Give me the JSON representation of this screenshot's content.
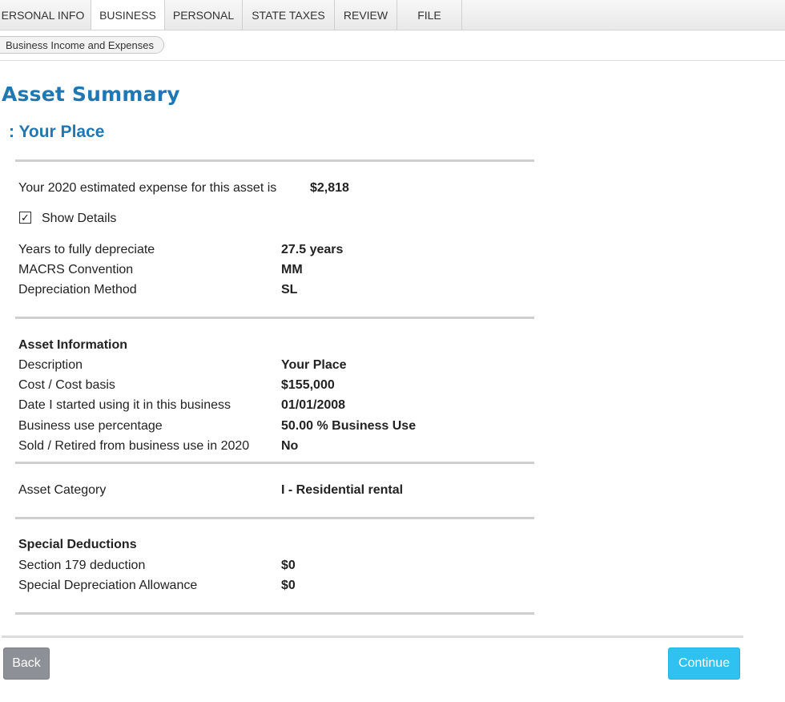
{
  "tabs": [
    {
      "label": "ERSONAL INFO",
      "active": false
    },
    {
      "label": "BUSINESS",
      "active": true
    },
    {
      "label": "PERSONAL",
      "active": false
    },
    {
      "label": "STATE TAXES",
      "active": false
    },
    {
      "label": "REVIEW",
      "active": false
    },
    {
      "label": "FILE",
      "active": false
    }
  ],
  "breadcrumb": "Business Income and Expenses",
  "page_title": "Asset Summary",
  "asset_subtitle": ": Your Place",
  "estimate": {
    "label": "Your 2020 estimated expense for this asset is",
    "value": "$2,818"
  },
  "show_details": {
    "label": "Show Details",
    "checked": true,
    "check_glyph": "✓"
  },
  "depreciation": [
    {
      "label": "Years to fully depreciate",
      "value": "27.5 years"
    },
    {
      "label": "MACRS Convention",
      "value": "MM"
    },
    {
      "label": "Depreciation Method",
      "value": "SL"
    }
  ],
  "asset_info": {
    "heading": "Asset Information",
    "rows": [
      {
        "label": "Description",
        "value": "Your Place"
      },
      {
        "label": "Cost / Cost basis",
        "value": "$155,000"
      },
      {
        "label": "Date I started using it in this business",
        "value": "01/01/2008"
      },
      {
        "label": "Business use percentage",
        "value": "50.00 % Business Use"
      },
      {
        "label": "Sold / Retired from business use in 2020",
        "value": "No"
      }
    ]
  },
  "asset_category": {
    "label": "Asset Category",
    "value": "I - Residential rental"
  },
  "special": {
    "heading": "Special Deductions",
    "rows": [
      {
        "label": "Section 179 deduction",
        "value": "$0"
      },
      {
        "label": "Special Depreciation Allowance",
        "value": "$0"
      }
    ]
  },
  "buttons": {
    "back": "Back",
    "continue": "Continue"
  },
  "colors": {
    "title": "#1f78b4",
    "continue": "#2fc2f0",
    "back": "#8d9096"
  }
}
